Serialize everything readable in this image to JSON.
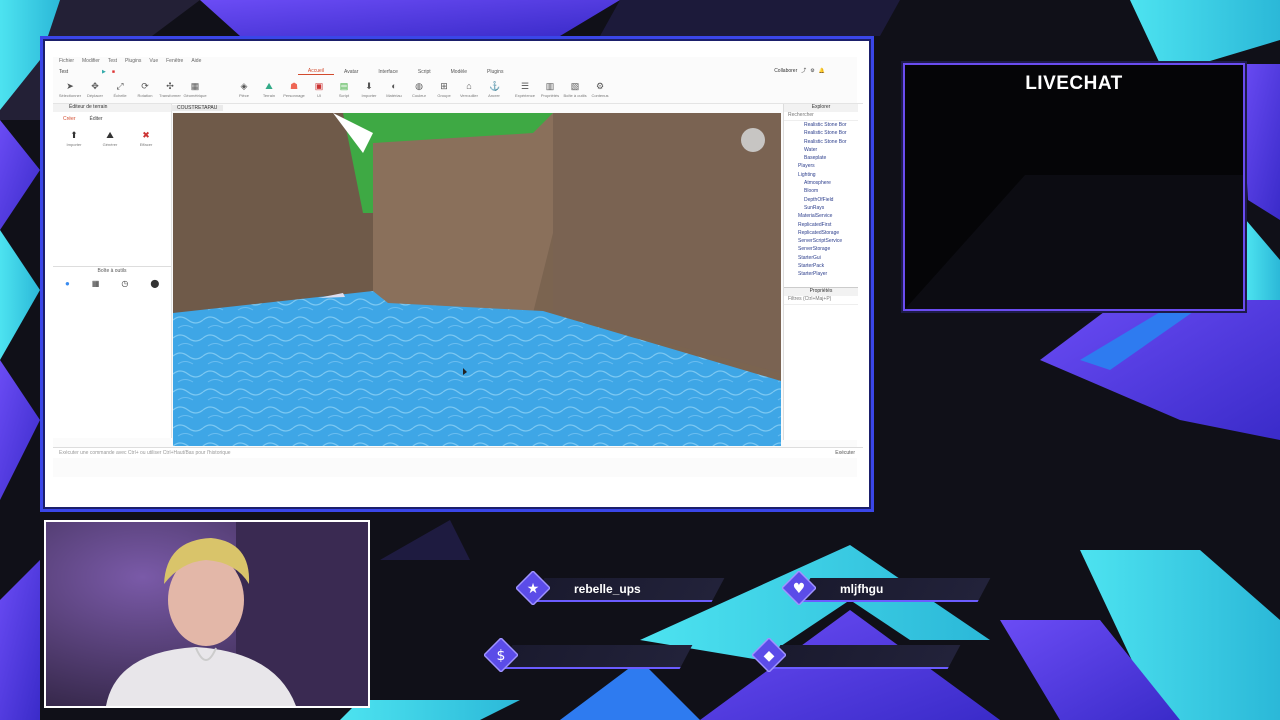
{
  "studio": {
    "menu": [
      "Fichier",
      "Modifier",
      "Test",
      "Plugins",
      "Vue",
      "Fenêtre",
      "Aide"
    ],
    "file_dropdown": "Test",
    "tabs": [
      {
        "label": "Accueil",
        "active": true
      },
      {
        "label": "Avatar",
        "active": false
      },
      {
        "label": "Interface",
        "active": false
      },
      {
        "label": "Script",
        "active": false
      },
      {
        "label": "Modèle",
        "active": false
      },
      {
        "label": "Plugins",
        "active": false
      }
    ],
    "collaborate_label": "Collaborer",
    "ribbon_tools": [
      "Sélectionner",
      "Déplacer",
      "Échelle",
      "Rotation",
      "Transformer",
      "Géométrique",
      "Pièce",
      "Terrain",
      "Personnage",
      "UI",
      "Script",
      "Importer",
      "Matériau",
      "Couleur",
      "Groupe",
      "Verrouiller",
      "Ancrer",
      "Expérience",
      "Propriétés",
      "Boîte à outils",
      "Contenus"
    ],
    "terrain_editor_title": "Éditeur de terrain",
    "document_tab": "COUSTRETAPAU",
    "left_tabs": [
      "Créer",
      "Éditer"
    ],
    "left_tools": [
      "Importer",
      "Générer",
      "Effacer"
    ],
    "toolbox_title": "Boîte à outils",
    "explorer": {
      "title": "Explorer",
      "search_placeholder": "Rechercher",
      "items": [
        {
          "label": "Realistic Stone Bor",
          "sub": true
        },
        {
          "label": "Realistic Stone Bor",
          "sub": true
        },
        {
          "label": "Realistic Stone Bor",
          "sub": true
        },
        {
          "label": "Water",
          "sub": true
        },
        {
          "label": "Baseplate",
          "sub": true
        },
        {
          "label": "Players",
          "sub": false
        },
        {
          "label": "Lighting",
          "sub": false
        },
        {
          "label": "Atmosphere",
          "sub": true
        },
        {
          "label": "Bloom",
          "sub": true
        },
        {
          "label": "DepthOfField",
          "sub": true
        },
        {
          "label": "SunRays",
          "sub": true
        },
        {
          "label": "MaterialService",
          "sub": false
        },
        {
          "label": "ReplicatedFirst",
          "sub": false
        },
        {
          "label": "ReplicatedStorage",
          "sub": false
        },
        {
          "label": "ServerScriptService",
          "sub": false
        },
        {
          "label": "ServerStorage",
          "sub": false
        },
        {
          "label": "StarterGui",
          "sub": false
        },
        {
          "label": "StarterPack",
          "sub": false
        },
        {
          "label": "StarterPlayer",
          "sub": false
        }
      ],
      "properties_title": "Propriétés",
      "properties_filter": "Filtres (Ctrl+Maj+P)"
    },
    "command_bar_placeholder": "Exécuter une commande avec Ctrl+ ou utiliser Ctrl+Haut/Bas pour l'historique",
    "run_label": "Exécuter"
  },
  "livechat": {
    "title": "LIVECHAT"
  },
  "social": [
    {
      "icon": "star-icon",
      "glyph": "★",
      "name": "rebelle_ups"
    },
    {
      "icon": "heart-icon",
      "glyph": "♥",
      "name": "mljfhgu"
    },
    {
      "icon": "dollar-icon",
      "glyph": "$",
      "name": ""
    },
    {
      "icon": "diamond-icon",
      "glyph": "◆",
      "name": ""
    }
  ],
  "colors": {
    "accent": "#6a4cf0",
    "cyan": "#3fd6e8",
    "frame_blue": "#3a46e8",
    "water": "#3ea6e6"
  }
}
